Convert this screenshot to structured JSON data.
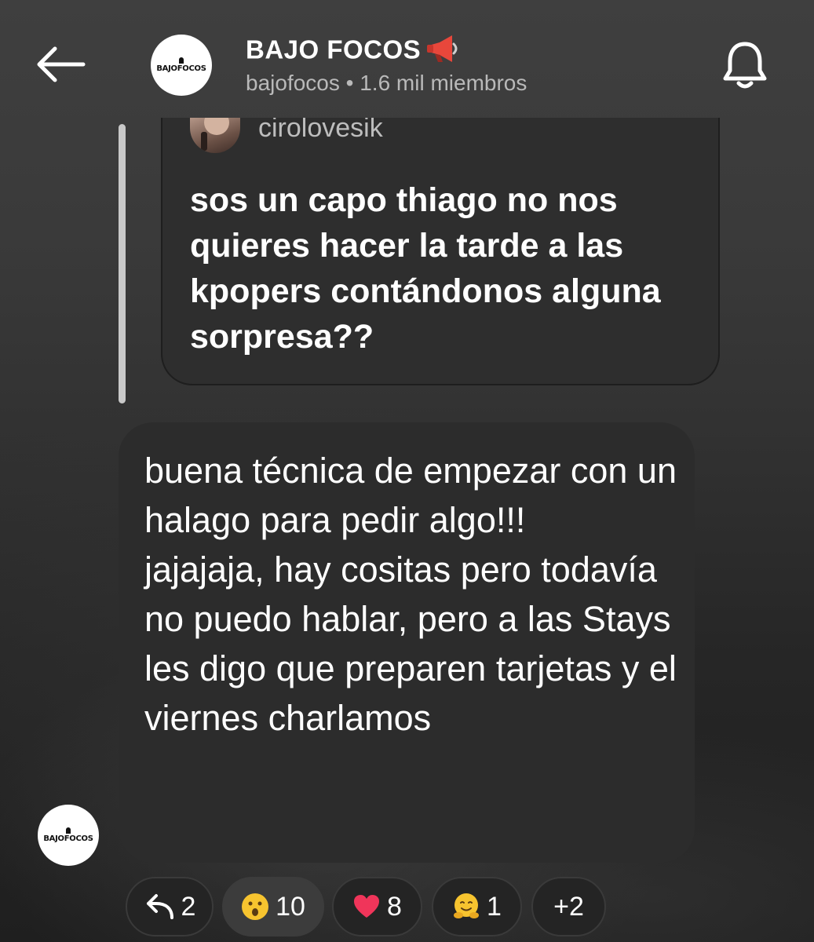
{
  "header": {
    "channel_name": "BAJO FOCOS",
    "channel_sub": "bajofocos • 1.6 mil miembros",
    "logo_text": "BAJOFOCOS",
    "icons": [
      "back-arrow-icon",
      "megaphone-icon",
      "bell-icon"
    ]
  },
  "quoted": {
    "username": "cirolovesik",
    "text": "sos un capo thiago no nos quieres hacer la tarde a las kpopers contándonos alguna sorpresa??"
  },
  "message": {
    "text": "buena técnica de empezar con un halago para pedir algo!!!\njajajaja, hay cositas pero todavía no puedo hablar, pero a las Stays les digo que preparen tarjetas y el viernes charlamos",
    "sender_logo_text": "BAJOFOCOS"
  },
  "reactions": [
    {
      "icon": "reply-icon",
      "count": "2"
    },
    {
      "icon": "surprised-face-icon",
      "count": "10",
      "selected": true
    },
    {
      "icon": "heart-icon",
      "count": "8"
    },
    {
      "icon": "hugging-face-icon",
      "count": "1"
    },
    {
      "label": "+2"
    }
  ],
  "colors": {
    "background_top": "#3f3f3f",
    "bubble": "#2c2c2c",
    "quote_card": "#2e2e2e",
    "secondary_text": "#b9b9b9",
    "heart": "#f0355a",
    "emoji_yellow": "#f7c42f"
  }
}
